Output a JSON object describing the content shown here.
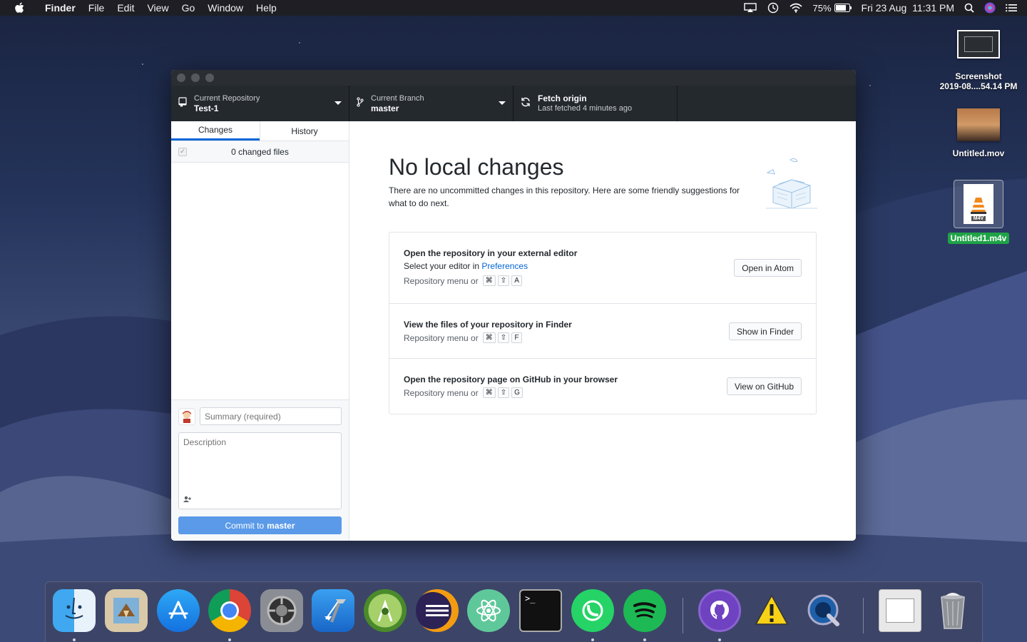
{
  "menubar": {
    "app_name": "Finder",
    "items": [
      "File",
      "Edit",
      "View",
      "Go",
      "Window",
      "Help"
    ],
    "battery": "75%",
    "datetime": "Fri 23 Aug  11:31 PM"
  },
  "desktop": {
    "icons": [
      {
        "label_line1": "Screenshot",
        "label_line2": "2019-08....54.14 PM"
      },
      {
        "label_line1": "Untitled.mov"
      },
      {
        "label_line1": "Untitled1.m4v",
        "badge": "M4V"
      }
    ]
  },
  "toolbar": {
    "repo": {
      "caption": "Current Repository",
      "value": "Test-1"
    },
    "branch": {
      "caption": "Current Branch",
      "value": "master"
    },
    "fetch": {
      "caption": "Fetch origin",
      "value": "Last fetched 4 minutes ago"
    }
  },
  "sidebar": {
    "tabs": [
      "Changes",
      "History"
    ],
    "changed_files": "0 changed files",
    "summary_placeholder": "Summary (required)",
    "description_placeholder": "Description",
    "commit_label": "Commit to",
    "commit_branch": "master"
  },
  "main": {
    "heading": "No local changes",
    "subtext": "There are no uncommitted changes in this repository. Here are some friendly suggestions for what to do next.",
    "suggestions": [
      {
        "title": "Open the repository in your external editor",
        "desc_prefix": "Select your editor in ",
        "desc_link": "Preferences",
        "shortcut_prefix": "Repository menu or",
        "keys": [
          "⌘",
          "⇧",
          "A"
        ],
        "button": "Open in Atom"
      },
      {
        "title": "View the files of your repository in Finder",
        "shortcut_prefix": "Repository menu or",
        "keys": [
          "⌘",
          "⇧",
          "F"
        ],
        "button": "Show in Finder"
      },
      {
        "title": "Open the repository page on GitHub in your browser",
        "shortcut_prefix": "Repository menu or",
        "keys": [
          "⌘",
          "⇧",
          "G"
        ],
        "button": "View on GitHub"
      }
    ]
  },
  "dock": {
    "apps": [
      "Finder",
      "Mail",
      "App Store",
      "Chrome",
      "System Preferences",
      "Xcode",
      "Android Studio",
      "Eclipse",
      "Atom",
      "Terminal",
      "WhatsApp",
      "Spotify",
      "GitHub Desktop",
      "Console",
      "QuickTime",
      "Preview",
      "Trash"
    ]
  },
  "colors": {
    "accent": "#0366d6",
    "toolbar_bg": "#24292e",
    "commit_button": "#5a9ae8",
    "selection_green": "#1fa347"
  }
}
